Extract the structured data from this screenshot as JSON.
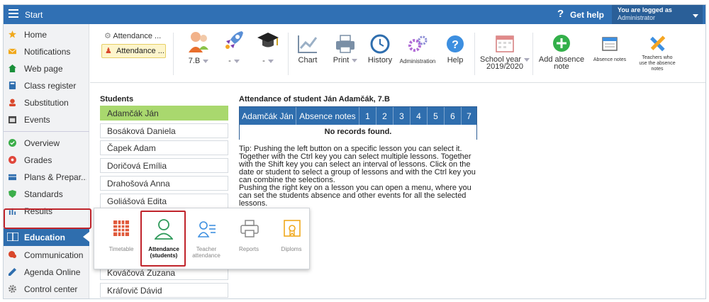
{
  "topbar": {
    "title": "Start",
    "help_symbol": "?",
    "help_label": "Get help",
    "user_line1": "You are logged as",
    "user_line2": "Administrator"
  },
  "sidebar": {
    "items": [
      {
        "label": "Home",
        "icon": "star-icon",
        "color": "#f0a81c"
      },
      {
        "label": "Notifications",
        "icon": "envelope-icon",
        "color": "#f0a81c"
      },
      {
        "label": "Web page",
        "icon": "home-icon",
        "color": "#1a8f3a"
      },
      {
        "label": "Class register",
        "icon": "book-icon",
        "color": "#2f6eae"
      },
      {
        "label": "Substitution",
        "icon": "person-icon",
        "color": "#d9472b"
      },
      {
        "label": "Events",
        "icon": "calendar-icon",
        "color": "#444444"
      },
      {
        "label": "Overview",
        "icon": "check-circle-icon",
        "color": "#3cae4a"
      },
      {
        "label": "Grades",
        "icon": "grade-icon",
        "color": "#e0473c"
      },
      {
        "label": "Plans & Prepar...",
        "icon": "plan-icon",
        "color": "#2f6eae"
      },
      {
        "label": "Standards",
        "icon": "shield-icon",
        "color": "#3cae4a"
      },
      {
        "label": "Results",
        "icon": "bar-chart-icon",
        "color": "#2f6eae"
      },
      {
        "label": "Education",
        "icon": "education-icon",
        "color": "#ffffff"
      },
      {
        "label": "Communication",
        "icon": "chat-icon",
        "color": "#d9472b"
      },
      {
        "label": "Agenda Online",
        "icon": "pencil-icon",
        "color": "#2f6eae"
      },
      {
        "label": "Control center",
        "icon": "gear-icon",
        "color": "#777777"
      }
    ]
  },
  "toolbar": {
    "toggle1": "Attendance ...",
    "toggle2": "Attendance ...",
    "class_value": "7.B",
    "filter2_value": "-",
    "filter3_value": "-",
    "chart": "Chart",
    "print": "Print",
    "history": "History",
    "administration": "Administration",
    "help": "Help",
    "school_year_l1": "School year",
    "school_year_l2": "2019/2020",
    "add_absence_l1": "Add absence",
    "add_absence_l2": "note",
    "absence_notes": "Absence notes",
    "teachers_l1": "Teachers who",
    "teachers_l2": "use the absence",
    "teachers_l3": "notes"
  },
  "students": {
    "heading": "Students",
    "list": [
      "Adamčák Ján",
      "Bosáková Daniela",
      "Čapek Adam",
      "Doričová Emília",
      "Drahošová Anna",
      "Goliášová Edita"
    ],
    "list_lower": [
      "Kováčová Zuzana",
      "Kráľovič Dávid"
    ]
  },
  "attendance": {
    "heading": "Attendance of student Ján Adamčák, 7.B",
    "columns": [
      "Adamčák Ján",
      "Absence notes",
      "1",
      "2",
      "3",
      "4",
      "5",
      "6",
      "7"
    ],
    "empty": "No records found.",
    "tip1": "Tip: Pushing the left button on a specific lesson you can select it. Together with the Ctrl key you can select multiple lessons. Together with the Shift key you can select an interval of lessons. Click on the date or student to select a group of lessons and with the Ctrl key you can combine the selections.",
    "tip2": "Pushing the right key on a lesson you can open a menu, where you can set the students absence and other events for all the selected lessons."
  },
  "education_menu": {
    "timetable": "Timetable",
    "attendance_students_l1": "Attendance",
    "attendance_students_l2": "(students)",
    "teacher_attendance_l1": "Teacher",
    "teacher_attendance_l2": "attendance",
    "reports": "Reports",
    "diploms": "Diploms"
  },
  "colors": {
    "brand_blue": "#3070b4",
    "selected_green": "#a9d86e",
    "highlight_red": "#c0242b"
  }
}
